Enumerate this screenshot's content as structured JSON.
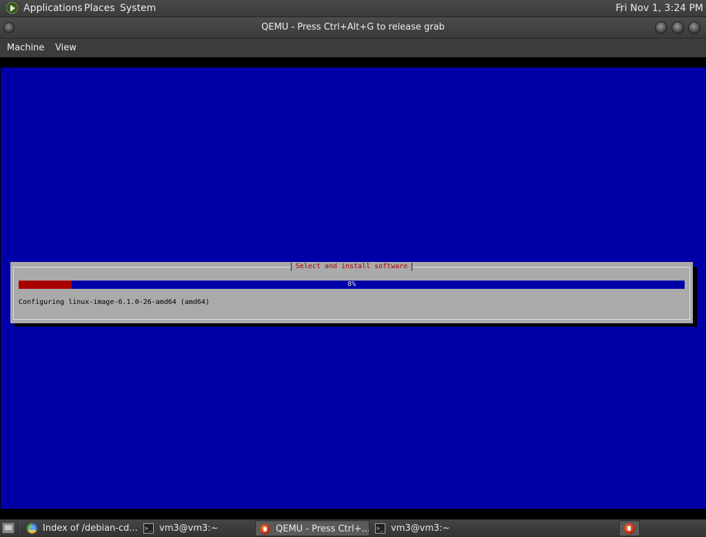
{
  "top_panel": {
    "menus": [
      "Applications",
      "Places",
      "System"
    ],
    "clock": "Fri Nov 1,  3:24 PM",
    "icon": "debian-swirl-icon"
  },
  "window": {
    "title": "QEMU - Press Ctrl+Alt+G to release grab",
    "menus": [
      "Machine",
      "View"
    ]
  },
  "installer": {
    "dialog_title": "Select and install software",
    "progress_percent": 8,
    "progress_label": "8%",
    "status": "Configuring linux-image-6.1.0-26-amd64 (amd64)",
    "colors": {
      "background": "#0000a8",
      "dialog": "#aaaaaa",
      "progress_fill": "#a80000",
      "title_text": "#a80000"
    }
  },
  "taskbar": {
    "tasks": [
      {
        "label": "Index of /debian-cd...",
        "icon": "chromium-icon",
        "active": false
      },
      {
        "label": "vm3@vm3:~",
        "icon": "terminal-icon",
        "active": false
      },
      {
        "label": "QEMU - Press Ctrl+...",
        "icon": "qemu-icon",
        "active": true
      },
      {
        "label": "vm3@vm3:~",
        "icon": "terminal-icon",
        "active": false
      }
    ],
    "tray_icon": "qemu-icon"
  }
}
